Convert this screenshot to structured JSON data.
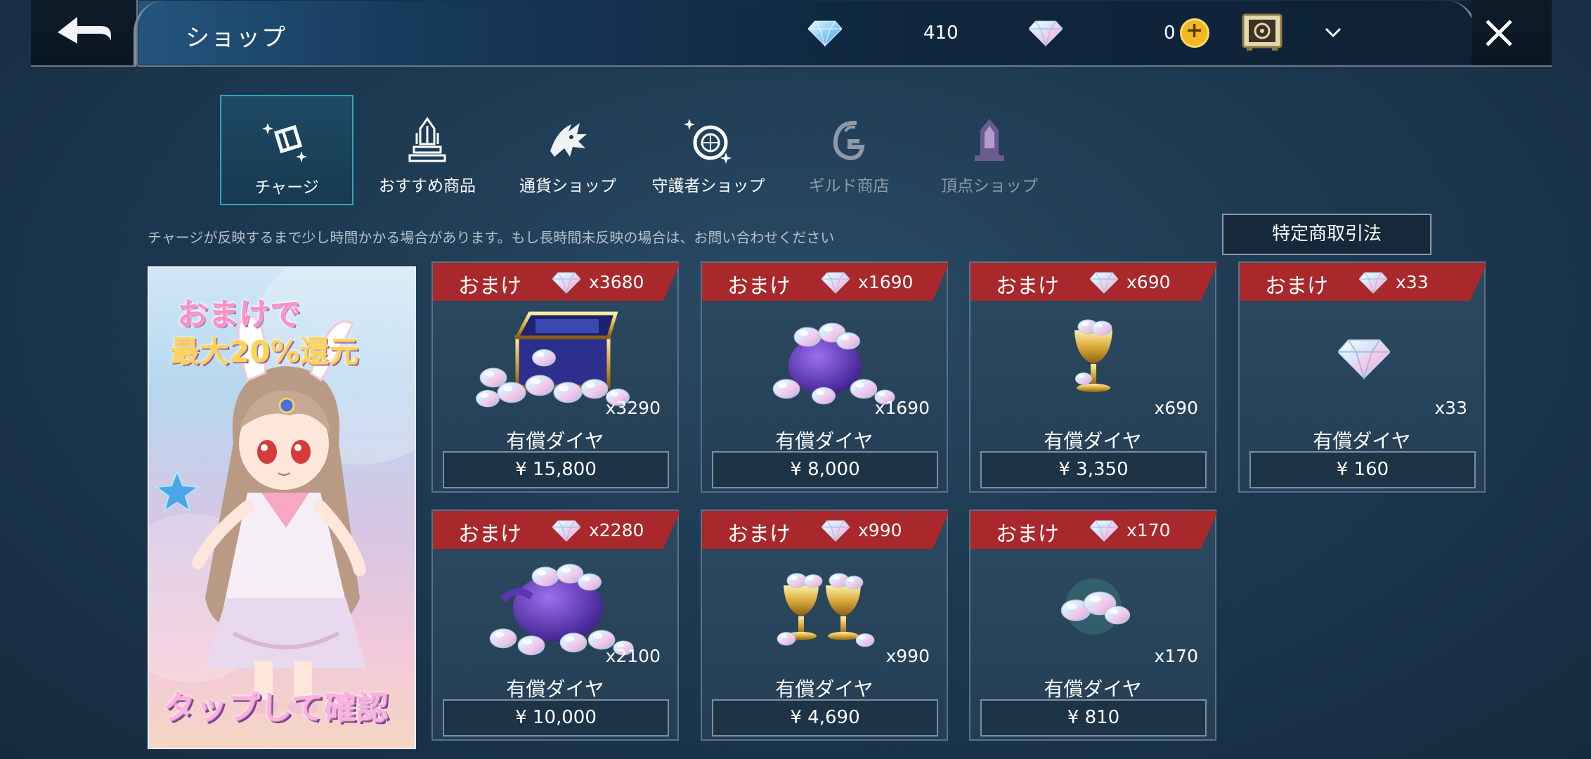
{
  "header": {
    "title": "ショップ",
    "paid_diamond_count": "410",
    "free_diamond_count": "0"
  },
  "tabs": [
    {
      "label": "チャージ",
      "active": true
    },
    {
      "label": "おすすめ商品",
      "active": false
    },
    {
      "label": "通貨ショップ",
      "active": false
    },
    {
      "label": "守護者ショップ",
      "active": false
    },
    {
      "label": "ギルド商店",
      "active": false,
      "disabled": true
    },
    {
      "label": "頂点ショップ",
      "active": false,
      "disabled": true
    }
  ],
  "notice": "チャージが反映するまで少し時間かかる場合があります。もし長時間未反映の場合は、お問い合わせください",
  "law_button": "特定商取引法",
  "banner": {
    "headline_1": "おまけで",
    "headline_2": "最大20%還元",
    "cta": "タップして確認"
  },
  "products": [
    {
      "bonus_label": "おまけ",
      "bonus_amount": "x3680",
      "quantity": "x3290",
      "name": "有償ダイヤ",
      "price": "¥ 15,800",
      "art": "chest"
    },
    {
      "bonus_label": "おまけ",
      "bonus_amount": "x1690",
      "quantity": "x1690",
      "name": "有償ダイヤ",
      "price": "¥ 8,000",
      "art": "bag-small"
    },
    {
      "bonus_label": "おまけ",
      "bonus_amount": "x690",
      "quantity": "x690",
      "name": "有償ダイヤ",
      "price": "¥ 3,350",
      "art": "goblet"
    },
    {
      "bonus_label": "おまけ",
      "bonus_amount": "x33",
      "quantity": "x33",
      "name": "有償ダイヤ",
      "price": "¥ 160",
      "art": "single-gem"
    },
    {
      "bonus_label": "おまけ",
      "bonus_amount": "x2280",
      "quantity": "x2100",
      "name": "有償ダイヤ",
      "price": "¥ 10,000",
      "art": "bag-large"
    },
    {
      "bonus_label": "おまけ",
      "bonus_amount": "x990",
      "quantity": "x990",
      "name": "有償ダイヤ",
      "price": "¥ 4,690",
      "art": "double-goblet"
    },
    {
      "bonus_label": "おまけ",
      "bonus_amount": "x170",
      "quantity": "x170",
      "name": "有償ダイヤ",
      "price": "¥ 810",
      "art": "gem-pile"
    }
  ],
  "colors": {
    "ribbon_red": "#a8282b",
    "active_tab_border": "#2fa7b6",
    "coin_gold": "#f2b824"
  }
}
